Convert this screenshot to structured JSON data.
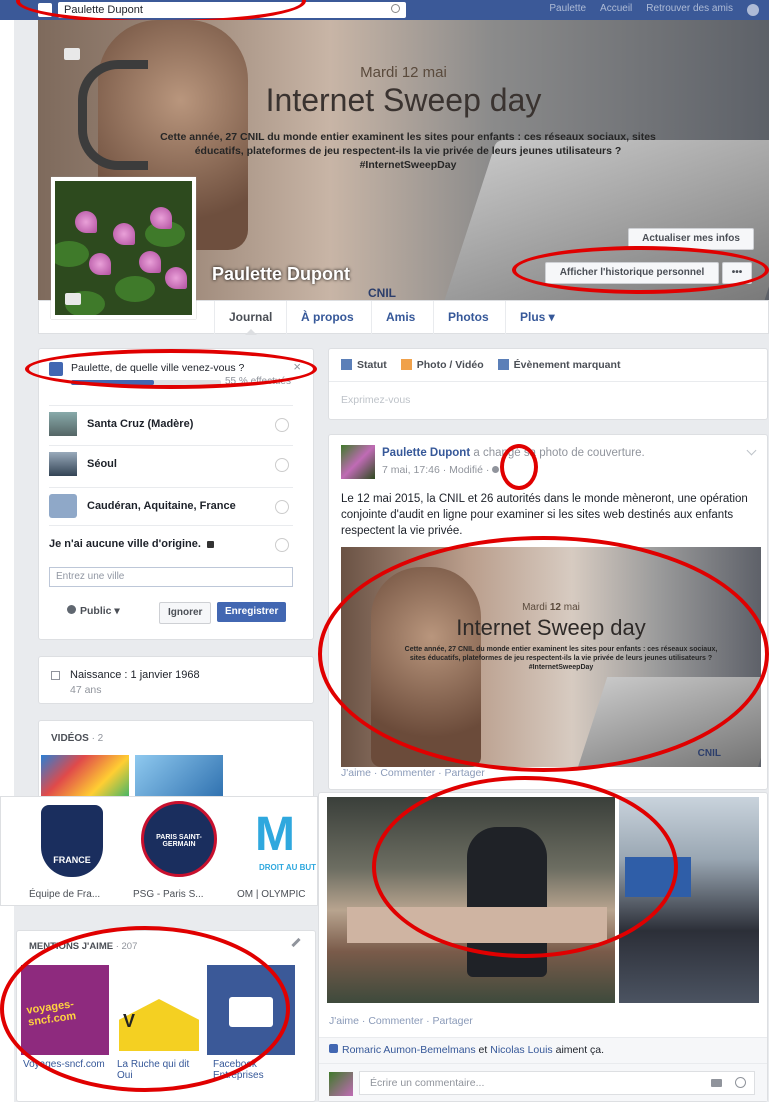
{
  "topbar": {
    "search_value": "Paulette Dupont",
    "nav": [
      "Paulette",
      "Accueil",
      "Retrouver des amis"
    ]
  },
  "cover": {
    "date_prefix": "Mardi ",
    "date_bold": "12",
    "date_suffix": " mai",
    "title": "Internet Sweep day",
    "text": "Cette année, 27 CNIL du monde entier examinent les sites pour enfants : ces réseaux sociaux, sites éducatifs, plateformes de jeu respectent-ils la vie privée de leurs jeunes utilisateurs ?",
    "hashtag": "#InternetSweepDay",
    "update_info_button": "Actualiser mes infos",
    "history_button": "Afficher l'historique personnel",
    "more_button": "•••",
    "cnil_mark": "CNIL"
  },
  "profile": {
    "name": "Paulette Dupont"
  },
  "tabs": [
    "Journal",
    "À propos",
    "Amis",
    "Photos",
    "Plus ▾"
  ],
  "city_prompt": {
    "question": "Paulette, de quelle ville venez-vous ?",
    "progress_label": "55 % effectués",
    "progress": 0.55,
    "close": "×",
    "options": [
      {
        "label": "Santa Cruz (Madère)"
      },
      {
        "label": "Séoul"
      },
      {
        "label": "Caudéran, Aquitaine, France"
      },
      {
        "label": "Je n'ai aucune ville d'origine."
      }
    ],
    "input_placeholder": "Entrez une ville",
    "privacy": "Public ▾",
    "ignore_button": "Ignorer",
    "save_button": "Enregistrer"
  },
  "birth": {
    "label": "Naissance : 1 janvier 1968",
    "age": "47 ans"
  },
  "videos": {
    "title": "VIDÉOS",
    "count": "· 2"
  },
  "pages_strip": [
    {
      "label": "Équipe de Fra...",
      "logo": "FRANCE"
    },
    {
      "label": "PSG - Paris S...",
      "logo": "PARIS SAINT-GERMAIN"
    },
    {
      "label": "OM | OLYMPIC",
      "logo": "DROIT AU BUT"
    }
  ],
  "mentions": {
    "title": "MENTIONS J'AIME",
    "count": "· 207",
    "items": [
      {
        "label": "Voyages-sncf.com",
        "logo": "voyages-sncf.com"
      },
      {
        "label": "La Ruche qui dit Oui",
        "logo": "V"
      },
      {
        "label": "Facebook Entreprises",
        "logo": ""
      }
    ]
  },
  "composer": {
    "tabs": [
      "Statut",
      "Photo / Vidéo",
      "Évènement marquant"
    ],
    "placeholder": "Exprimez-vous"
  },
  "post": {
    "author": "Paulette Dupont",
    "action": " a changé sa photo de couverture.",
    "time": "7 mai, 17:46 · Modifié · ",
    "text": "Le 12 mai 2015, la CNIL et 26 autorités dans le monde mèneront, une opération conjointe d'audit en ligne pour examiner si les sites web destinés aux enfants respectent la vie privée.",
    "actions": "J'aime · Commenter · Partager"
  },
  "post2": {
    "actions": "J'aime · Commenter · Partager",
    "likers_1": "Romaric Aumon-Bemelmans",
    "likers_and": " et ",
    "likers_2": "Nicolas Louis",
    "likers_suffix": " aiment ça.",
    "comment_placeholder": "Écrire un commentaire..."
  },
  "colors": {
    "facebook_blue": "#3b5998",
    "link": "#365899",
    "annotation_red": "#e00000"
  }
}
